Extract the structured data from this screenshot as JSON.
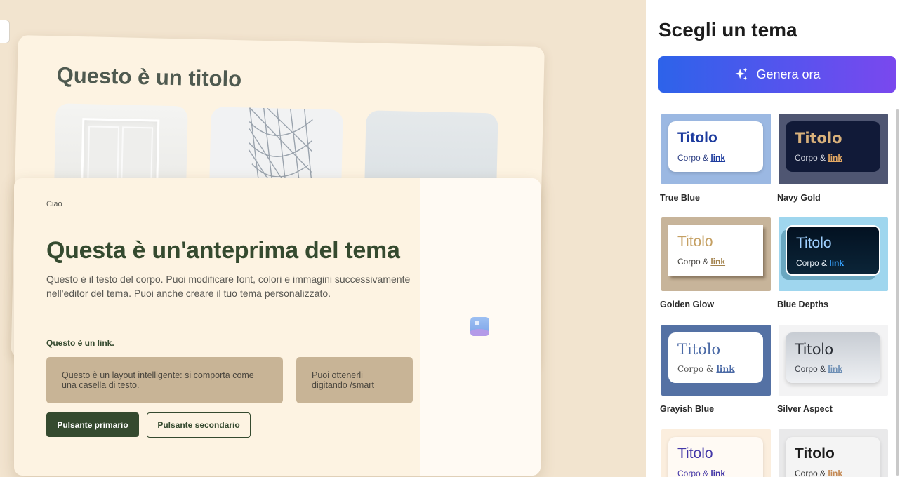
{
  "preview": {
    "back_title": "Questo è un titolo",
    "hello": "Ciao",
    "title": "Questa è un'anteprima del tema",
    "body": "Questo è il testo del corpo. Puoi modificare font, colori e immagini successivamente nell'editor del tema. Puoi anche creare il tuo tema personalizzato.",
    "link": "Questo è un link.",
    "smart_box_1": "Questo è un layout intelligente: si comporta come una casella di testo.",
    "smart_box_2": "Puoi ottenerli digitando /smart",
    "primary_button": "Pulsante primario",
    "secondary_button": "Pulsante secondario"
  },
  "panel": {
    "title": "Scegli un tema",
    "generate_button": "Genera ora",
    "generate_icon": "sparkles-icon"
  },
  "themes": [
    {
      "name": "True Blue",
      "title": "Titolo",
      "body": "Corpo &",
      "link": "link"
    },
    {
      "name": "Navy Gold",
      "title": "Titolo",
      "body": "Corpo &",
      "link": "link"
    },
    {
      "name": "Golden Glow",
      "title": "Titolo",
      "body": "Corpo &",
      "link": "link"
    },
    {
      "name": "Blue Depths",
      "title": "Titolo",
      "body": "Corpo &",
      "link": "link"
    },
    {
      "name": "Grayish Blue",
      "title": "Titolo",
      "body": "Corpo &",
      "link": "link"
    },
    {
      "name": "Silver Aspect",
      "title": "Titolo",
      "body": "Corpo &",
      "link": "link"
    },
    {
      "name": "",
      "title": "Titolo",
      "body": "Corpo &",
      "link": "link"
    },
    {
      "name": "",
      "title": "Titolo",
      "body": "Corpo &",
      "link": "link"
    }
  ],
  "colors": {
    "accent_green": "#354a2f",
    "generate_gradient_start": "#2d63ea",
    "generate_gradient_end": "#7a48ee",
    "background": "#f2e4cf"
  }
}
